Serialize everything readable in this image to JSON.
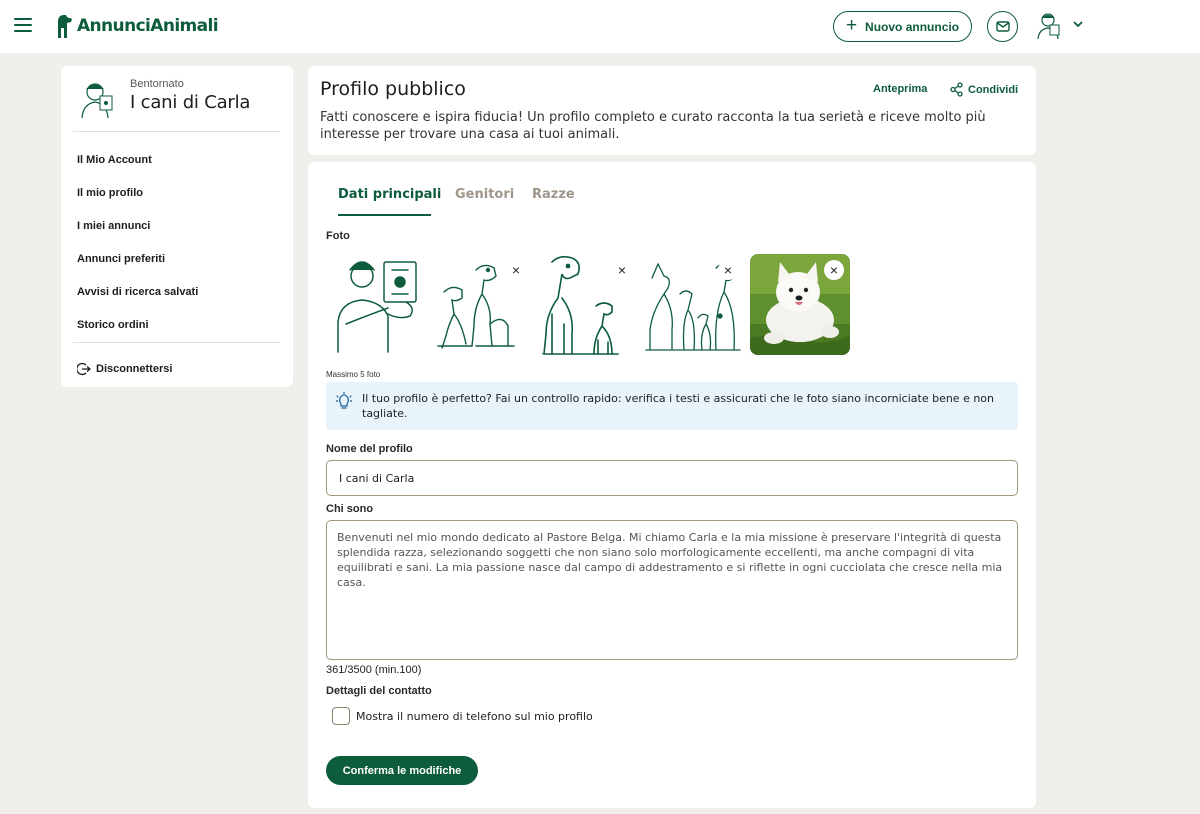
{
  "header": {
    "logo_text": "AnnunciAnimali",
    "new_ad_label": "Nuovo annuncio"
  },
  "sidebar": {
    "welcome": "Bentornato",
    "username": "I cani di Carla",
    "items": [
      {
        "label": "Il Mio Account"
      },
      {
        "label": "Il mio profilo"
      },
      {
        "label": "I miei annunci"
      },
      {
        "label": "Annunci preferiti"
      },
      {
        "label": "Avvisi di ricerca salvati"
      },
      {
        "label": "Storico ordini"
      }
    ],
    "logout": "Disconnettersi"
  },
  "top": {
    "title": "Profilo pubblico",
    "preview": "Anteprima",
    "share": "Condividi",
    "description": "Fatti conoscere e ispira fiducia! Un profilo completo e curato racconta la tua serietà e riceve molto più interesse per trovare una casa ai tuoi animali."
  },
  "tabs": [
    {
      "label": "Dati principali",
      "active": true
    },
    {
      "label": "Genitori",
      "active": false
    },
    {
      "label": "Razze",
      "active": false
    }
  ],
  "form": {
    "photos_label": "Foto",
    "photos_max": "Massimo 5 foto",
    "tip": "Il tuo profilo è perfetto? Fai un controllo rapido: verifica i testi e assicurati che le foto siano incorniciate bene e non tagliate.",
    "name_label": "Nome del profilo",
    "name_value": "I cani di Carla",
    "about_label": "Chi sono",
    "about_value": "Benvenuti nel mio mondo dedicato al Pastore Belga. Mi chiamo Carla e la mia missione è preservare l'integrità di questa splendida razza, selezionando soggetti che non siano solo morfologicamente eccellenti, ma anche compagni di vita equilibrati e sani. La mia passione nasce dal campo di addestramento e si riflette in ogni cucciolata che cresce nella mia casa.",
    "counter": "361/3500 (min.100)",
    "contact_label": "Dettagli del contatto",
    "show_phone_label": "Mostra il numero di telefono sul mio profilo",
    "show_phone_checked": false,
    "confirm": "Conferma le modifiche"
  },
  "colors": {
    "brand": "#0d5c3b",
    "background": "#f1efeb",
    "tip_bg": "#e8f3fa",
    "tab_inactive": "#a09588"
  }
}
